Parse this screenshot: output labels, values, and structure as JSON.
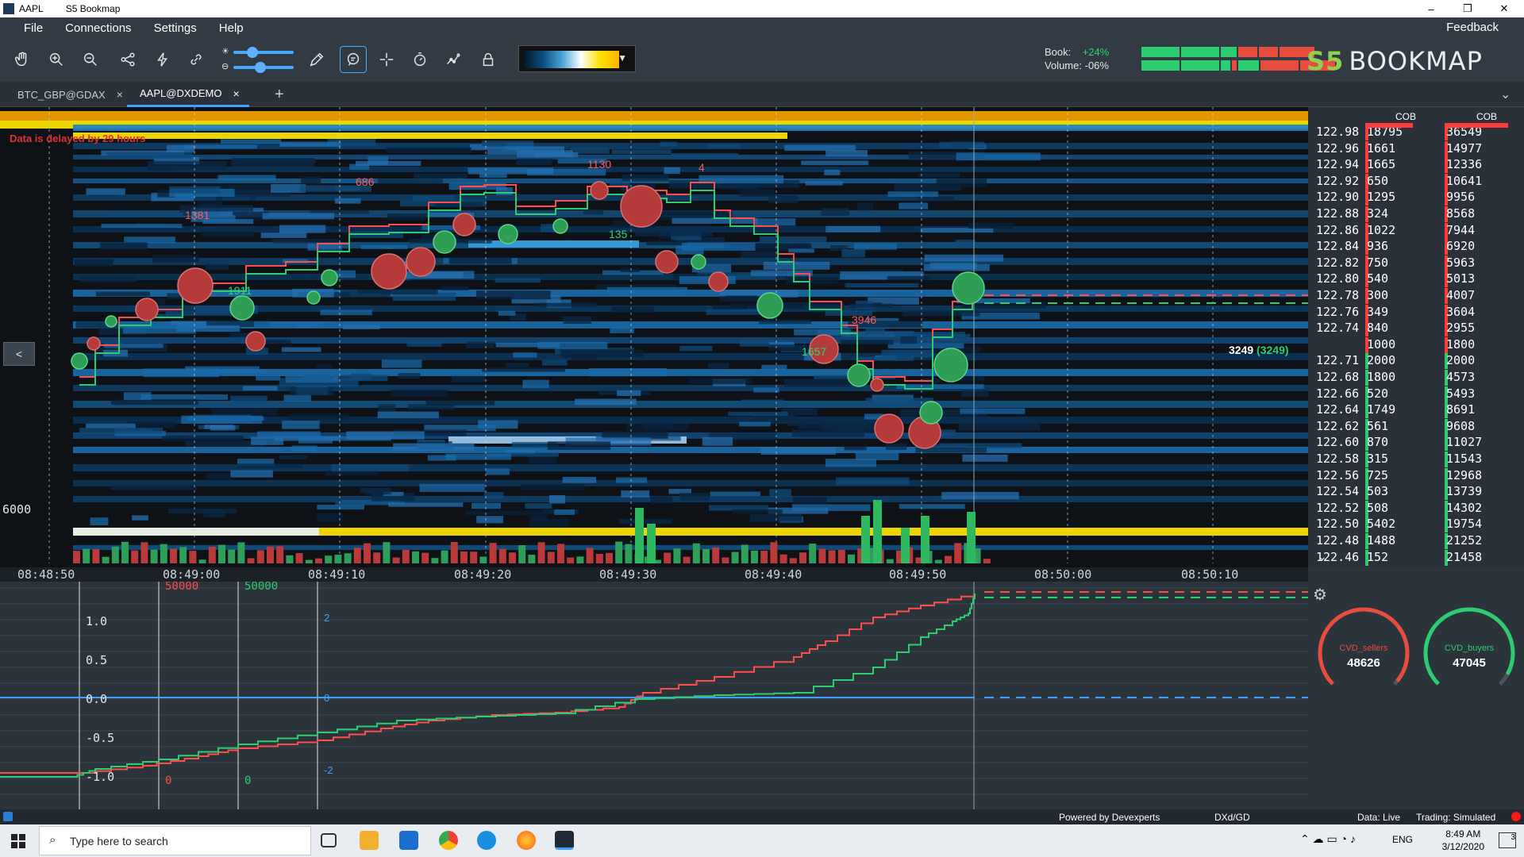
{
  "window": {
    "title": "AAPL",
    "app_title": "S5 Bookmap",
    "min": "–",
    "restore": "❐",
    "close": "✕"
  },
  "menu": {
    "file": "File",
    "connections": "Connections",
    "settings": "Settings",
    "help": "Help",
    "feedback": "Feedback"
  },
  "toolbar": {
    "icons": [
      "hand-icon",
      "zoom-in-icon",
      "zoom-out-icon",
      "share-icon",
      "lightning-icon",
      "link-icon",
      "pencil-icon",
      "chat-icon",
      "crosshair-icon",
      "timer-icon",
      "chart-line-icon",
      "lock-icon"
    ],
    "book_label": "Book:",
    "book_value": "+24%",
    "volume_label": "Volume:",
    "volume_value": "-06%",
    "logo_s5": "S5",
    "logo_text": "BOOKMAP"
  },
  "tabs": [
    {
      "label": "BTC_GBP@GDAX",
      "close": "×"
    },
    {
      "label": "AAPL@DXDEMO",
      "close": "×"
    }
  ],
  "tabs_add": "+",
  "tabs_menu": "⌄",
  "chart": {
    "delay_notice": "Data is delayed by 29 hours",
    "left_volume_label": "6000",
    "collapse_button": "<",
    "last_trade_label": "3249",
    "last_trade_sub": "(3249)",
    "annotations": [
      {
        "text": "1381",
        "color": "#ff5b5b"
      },
      {
        "text": "1911",
        "color": "#2ed573"
      },
      {
        "text": "686",
        "color": "#ff5b5b"
      },
      {
        "text": "1130",
        "color": "#ff5b5b"
      },
      {
        "text": "4",
        "color": "#ff5b5b"
      },
      {
        "text": "135",
        "color": "#2ed573"
      },
      {
        "text": "3946",
        "color": "#ff5b5b"
      },
      {
        "text": "1657",
        "color": "#2ed573"
      }
    ],
    "time_ticks": [
      "08:48:50",
      "08:49:00",
      "08:49:10",
      "08:49:20",
      "08:49:30",
      "08:49:40",
      "08:49:50",
      "08:50:00",
      "08:50:10"
    ]
  },
  "order_book": {
    "header_left": "COB",
    "header_right": "COB",
    "rows": [
      {
        "price": "122.98",
        "cob1": "18795",
        "cob2": "36549",
        "side": "ask"
      },
      {
        "price": "122.96",
        "cob1": "1661",
        "cob2": "14977",
        "side": "ask"
      },
      {
        "price": "122.94",
        "cob1": "1665",
        "cob2": "12336",
        "side": "ask"
      },
      {
        "price": "122.92",
        "cob1": "650",
        "cob2": "10641",
        "side": "ask"
      },
      {
        "price": "122.90",
        "cob1": "1295",
        "cob2": "9956",
        "side": "ask"
      },
      {
        "price": "122.88",
        "cob1": "324",
        "cob2": "8568",
        "side": "ask"
      },
      {
        "price": "122.86",
        "cob1": "1022",
        "cob2": "7944",
        "side": "ask"
      },
      {
        "price": "122.84",
        "cob1": "936",
        "cob2": "6920",
        "side": "ask"
      },
      {
        "price": "122.82",
        "cob1": "750",
        "cob2": "5963",
        "side": "ask"
      },
      {
        "price": "122.80",
        "cob1": "540",
        "cob2": "5013",
        "side": "ask"
      },
      {
        "price": "122.78",
        "cob1": "300",
        "cob2": "4007",
        "side": "ask"
      },
      {
        "price": "122.76",
        "cob1": "349",
        "cob2": "3604",
        "side": "ask"
      },
      {
        "price": "122.74",
        "cob1": "840",
        "cob2": "2955",
        "side": "ask"
      },
      {
        "price": "",
        "cob1": "1000",
        "cob2": "1800",
        "side": "ask"
      },
      {
        "price": "122.71",
        "cob1": "2000",
        "cob2": "2000",
        "side": "bid"
      },
      {
        "price": "122.68",
        "cob1": "1800",
        "cob2": "4573",
        "side": "bid"
      },
      {
        "price": "122.66",
        "cob1": "520",
        "cob2": "5493",
        "side": "bid"
      },
      {
        "price": "122.64",
        "cob1": "1749",
        "cob2": "8691",
        "side": "bid"
      },
      {
        "price": "122.62",
        "cob1": "561",
        "cob2": "9608",
        "side": "bid"
      },
      {
        "price": "122.60",
        "cob1": "870",
        "cob2": "11027",
        "side": "bid"
      },
      {
        "price": "122.58",
        "cob1": "315",
        "cob2": "11543",
        "side": "bid"
      },
      {
        "price": "122.56",
        "cob1": "725",
        "cob2": "12968",
        "side": "bid"
      },
      {
        "price": "122.54",
        "cob1": "503",
        "cob2": "13739",
        "side": "bid"
      },
      {
        "price": "122.52",
        "cob1": "508",
        "cob2": "14302",
        "side": "bid"
      },
      {
        "price": "122.50",
        "cob1": "5402",
        "cob2": "19754",
        "side": "bid"
      },
      {
        "price": "122.48",
        "cob1": "1488",
        "cob2": "21252",
        "side": "bid"
      },
      {
        "price": "122.46",
        "cob1": "152",
        "cob2": "21458",
        "side": "bid"
      }
    ],
    "scroll_arrow": "⌄"
  },
  "indicator": {
    "y_ticks": [
      "1.0",
      "0.5",
      "0.0",
      "-0.5",
      "-1.0"
    ],
    "sellers_scale_top": "50000",
    "buyers_scale_top": "50000",
    "sellers_scale_bottom": "0",
    "buyers_scale_bottom": "0",
    "right_scale": [
      "2",
      "0",
      "-2"
    ]
  },
  "gauges": [
    {
      "name": "CVD_sellers",
      "value": "48626",
      "color": "#e74c3c",
      "level": 0.49
    },
    {
      "name": "CVD_buyers",
      "value": "47045",
      "color": "#2ecc71",
      "level": 0.47
    }
  ],
  "status": {
    "powered": "Powered by Devexperts",
    "feed": "DXd/GD",
    "data": "Data: Live",
    "trading": "Trading: Simulated"
  },
  "taskbar": {
    "search_placeholder": "Type here to search",
    "lang": "ENG",
    "time": "8:49 AM",
    "date": "3/12/2020",
    "notif": "3"
  },
  "colors": {
    "ask": "#ff3b3b",
    "bid": "#2ecc71",
    "accent": "#3da0ff",
    "yellow": "#ffe600"
  }
}
